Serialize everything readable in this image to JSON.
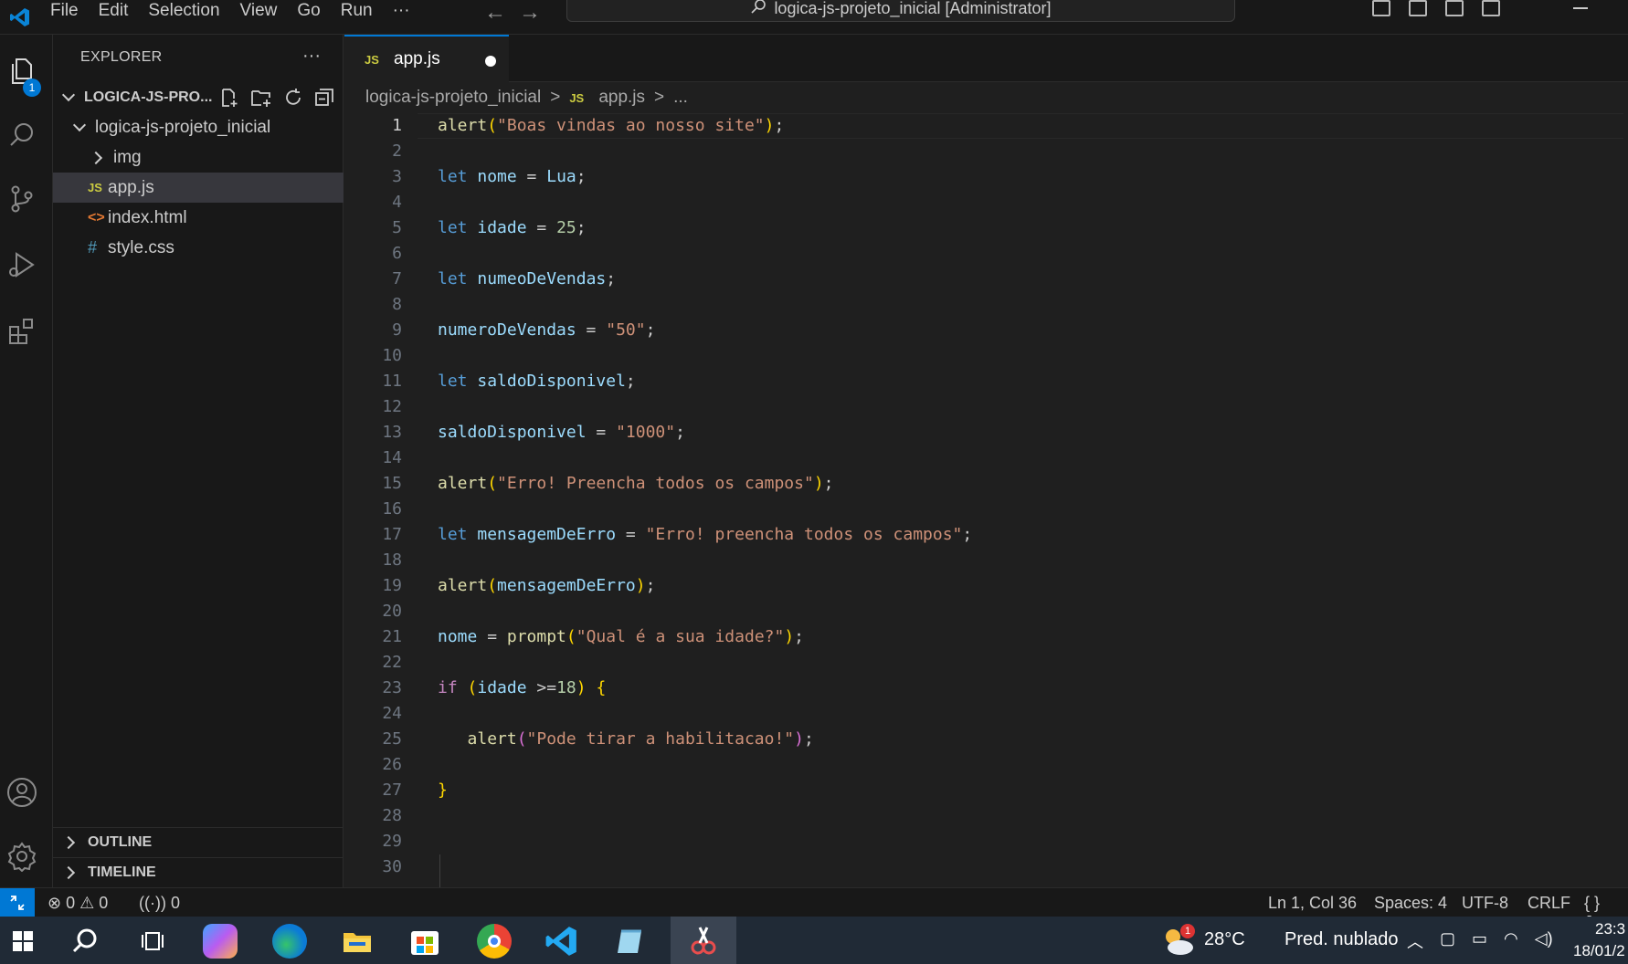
{
  "titlebar": {
    "menu": [
      "File",
      "Edit",
      "Selection",
      "View",
      "Go",
      "Run",
      "···"
    ],
    "search_text": "logica-js-projeto_inicial [Administrator]"
  },
  "activity": {
    "explorer_badge": "1"
  },
  "sidebar": {
    "title": "EXPLORER",
    "more": "···",
    "project_root": "LOGICA-JS-PRO...",
    "folder": "logica-js-projeto_inicial",
    "items": [
      {
        "name": "img",
        "icon": "chevron-right"
      },
      {
        "name": "app.js",
        "icon": "JS"
      },
      {
        "name": "index.html",
        "icon": "<>"
      },
      {
        "name": "style.css",
        "icon": "#"
      }
    ],
    "outline": "OUTLINE",
    "timeline": "TIMELINE"
  },
  "tab": {
    "label": "app.js",
    "icon": "JS"
  },
  "breadcrumb": {
    "folder": "logica-js-projeto_inicial",
    "sep": ">",
    "file_icon": "JS",
    "file": "app.js",
    "tail": "..."
  },
  "editor": {
    "line_numbers": [
      "1",
      "2",
      "3",
      "4",
      "5",
      "6",
      "7",
      "8",
      "9",
      "10",
      "11",
      "12",
      "13",
      "14",
      "15",
      "16",
      "17",
      "18",
      "19",
      "20",
      "21",
      "22",
      "23",
      "24",
      "25",
      "26",
      "27",
      "28",
      "29",
      "30"
    ],
    "t": {
      "alert": "alert",
      "let": "let",
      "if": "if",
      "prompt": "prompt",
      "l1_str": "\"Boas vindas ao nosso site\"",
      "nome": "nome",
      "lua": "Lua",
      "idade": "idade",
      "n25": "25",
      "numeo": "numeoDeVendas",
      "numero": "numeroDeVendas",
      "s50": "\"50\"",
      "saldo": "saldoDisponivel",
      "s1000": "\"1000\"",
      "l15_str": "\"Erro! Preencha todos os campos\"",
      "msg": "mensagemDeErro",
      "l17_str": "\"Erro! preencha todos os campos\"",
      "l21_str": "\"Qual é a sua idade?\"",
      "n18": "18",
      "l25_str": "\"Pode tirar a habilitacao!\""
    }
  },
  "status": {
    "errors": "0",
    "warnings": "0",
    "ports": "0",
    "position": "Ln 1, Col 36",
    "spaces": "Spaces: 4",
    "encoding": "UTF-8",
    "eol": "CRLF",
    "lang": "{ } Jav"
  },
  "taskbar": {
    "weather_badge": "1",
    "temp": "28°C",
    "weather": "Pred. nublado",
    "time": "23:3",
    "date": "18/01/2"
  }
}
